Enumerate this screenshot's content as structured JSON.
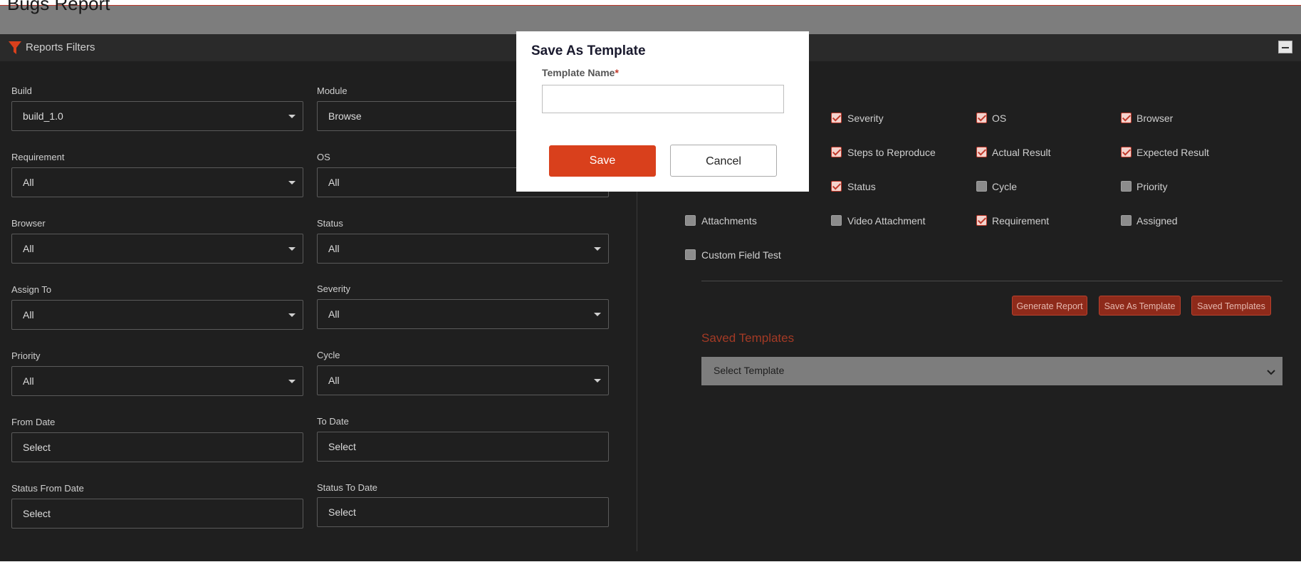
{
  "page": {
    "title": "Bugs Report"
  },
  "filter_bar": {
    "label": "Reports Filters",
    "icon": "funnel-icon"
  },
  "filters": {
    "build": {
      "label": "Build",
      "value": "build_1.0"
    },
    "module": {
      "label": "Module",
      "value": "Browse"
    },
    "requirement": {
      "label": "Requirement",
      "value": "All"
    },
    "os": {
      "label": "OS",
      "value": "All"
    },
    "browser": {
      "label": "Browser",
      "value": "All"
    },
    "status": {
      "label": "Status",
      "value": "All"
    },
    "assign_to": {
      "label": "Assign To",
      "value": "All"
    },
    "severity": {
      "label": "Severity",
      "value": "All"
    },
    "priority": {
      "label": "Priority",
      "value": "All"
    },
    "cycle": {
      "label": "Cycle",
      "value": "All"
    },
    "from_date": {
      "label": "From Date",
      "value": "Select"
    },
    "to_date": {
      "label": "To Date",
      "value": "Select"
    },
    "status_from_date": {
      "label": "Status From Date",
      "value": "Select"
    },
    "status_to_date": {
      "label": "Status To Date",
      "value": "Select"
    }
  },
  "columns": {
    "severity": {
      "label": "Severity",
      "checked": true
    },
    "os": {
      "label": "OS",
      "checked": true
    },
    "browser": {
      "label": "Browser",
      "checked": true
    },
    "steps": {
      "label": "Steps to Reproduce",
      "checked": true
    },
    "actual": {
      "label": "Actual Result",
      "checked": true
    },
    "expected": {
      "label": "Expected Result",
      "checked": true
    },
    "status": {
      "label": "Status",
      "checked": true
    },
    "cycle": {
      "label": "Cycle",
      "checked": false
    },
    "priority": {
      "label": "Priority",
      "checked": false
    },
    "attachments": {
      "label": "Attachments",
      "checked": false
    },
    "video": {
      "label": "Video Attachment",
      "checked": false
    },
    "requirement": {
      "label": "Requirement",
      "checked": true
    },
    "assigned": {
      "label": "Assigned",
      "checked": false
    },
    "custom": {
      "label": "Custom Field Test",
      "checked": false
    }
  },
  "actions": {
    "generate": "Generate Report",
    "save_as_template": "Save As Template",
    "saved_templates": "Saved Templates"
  },
  "saved_templates": {
    "heading": "Saved Templates",
    "select_value": "Select Template"
  },
  "modal": {
    "title": "Save As Template",
    "field_label": "Template Name",
    "required_mark": "*",
    "field_value": "",
    "save_label": "Save",
    "cancel_label": "Cancel"
  },
  "colors": {
    "accent": "#d9401c",
    "panel_bg": "#1f1f1f",
    "header_bg": "#2a2a2a"
  }
}
